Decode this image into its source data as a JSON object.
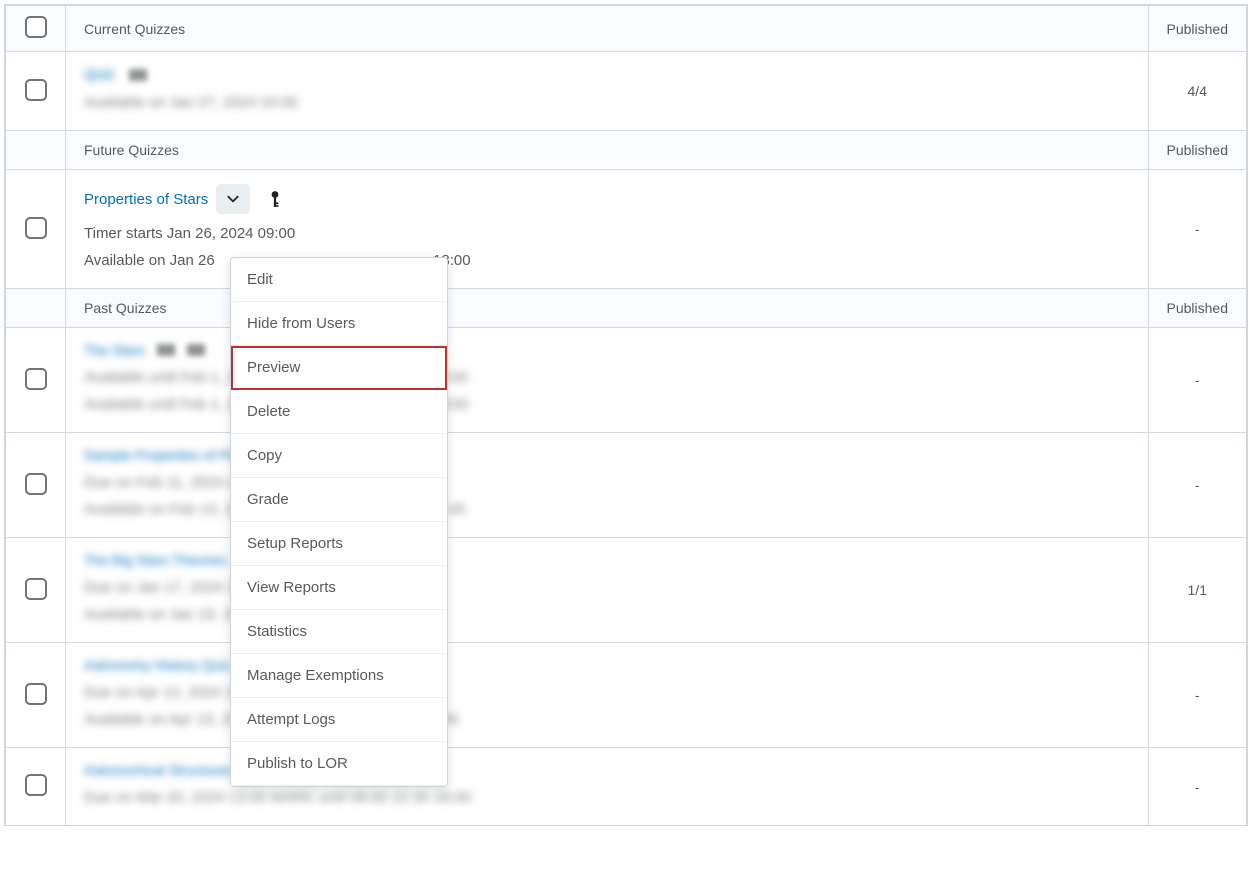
{
  "sections": {
    "current": {
      "label": "Current Quizzes",
      "published_header": "Published"
    },
    "future": {
      "label": "Future Quizzes",
      "published_header": "Published"
    },
    "past": {
      "label": "Past Quizzes",
      "published_header": "Published"
    }
  },
  "current_row": {
    "published": "4/4"
  },
  "future_row": {
    "title": "Properties of Stars",
    "timer_line": "Timer starts Jan 26, 2024 09:00",
    "avail_before": "Available on Jan 26",
    "avail_after": "18:00",
    "published": "-"
  },
  "past_rows": [
    {
      "published": "-"
    },
    {
      "published": "-"
    },
    {
      "published": "1/1"
    },
    {
      "published": "-"
    },
    {
      "published": "-"
    }
  ],
  "menu": {
    "items": [
      {
        "label": "Edit",
        "highlight": false
      },
      {
        "label": "Hide from Users",
        "highlight": false
      },
      {
        "label": "Preview",
        "highlight": true
      },
      {
        "label": "Delete",
        "highlight": false
      },
      {
        "label": "Copy",
        "highlight": false
      },
      {
        "label": "Grade",
        "highlight": false
      },
      {
        "label": "Setup Reports",
        "highlight": false
      },
      {
        "label": "View Reports",
        "highlight": false
      },
      {
        "label": "Statistics",
        "highlight": false
      },
      {
        "label": "Manage Exemptions",
        "highlight": false
      },
      {
        "label": "Attempt Logs",
        "highlight": false
      },
      {
        "label": "Publish to LOR",
        "highlight": false
      }
    ]
  }
}
